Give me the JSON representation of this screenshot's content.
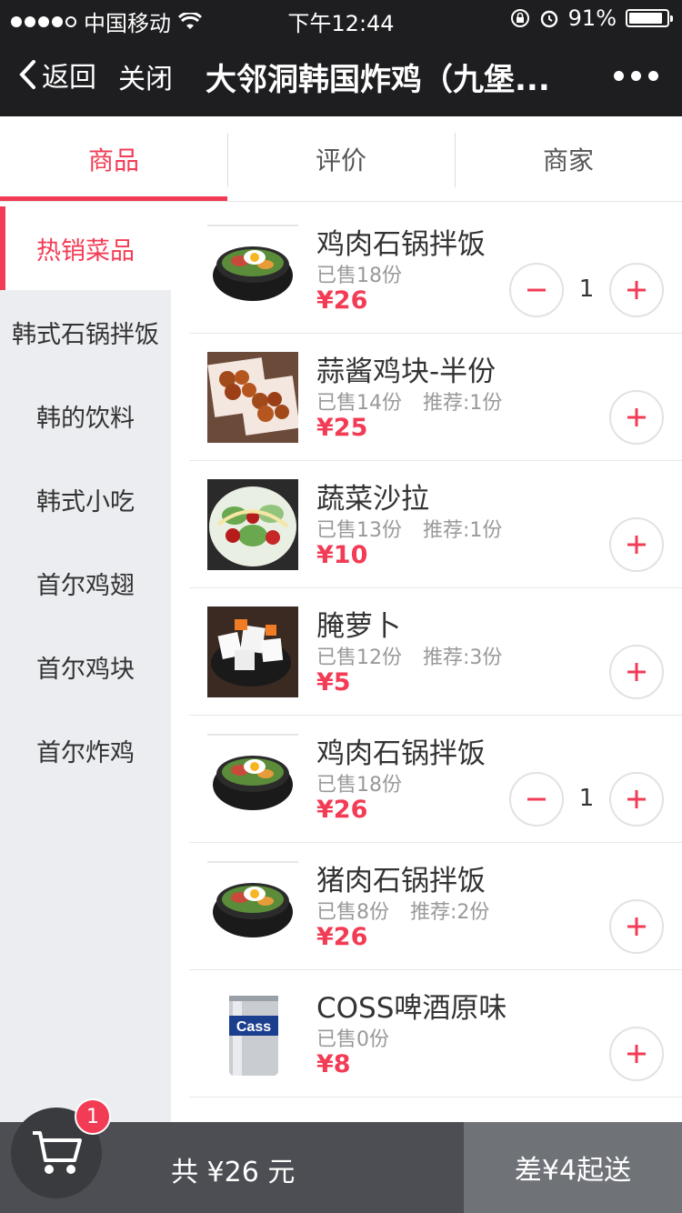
{
  "status_bar": {
    "carrier": "中国移动",
    "time": "下午12:44",
    "battery": "91%",
    "battery_level": 0.91
  },
  "nav": {
    "back_label": "返回",
    "close_label": "关闭",
    "title": "大邻洞韩国炸鸡（九堡..."
  },
  "tabs": [
    {
      "label": "商品"
    },
    {
      "label": "评价"
    },
    {
      "label": "商家"
    }
  ],
  "sidebar": {
    "items": [
      {
        "label": "热销菜品"
      },
      {
        "label": "韩式石锅拌饭"
      },
      {
        "label": "韩的饮料"
      },
      {
        "label": "韩式小吃"
      },
      {
        "label": "首尔鸡翅"
      },
      {
        "label": "首尔鸡块"
      },
      {
        "label": "首尔炸鸡"
      }
    ]
  },
  "products": [
    {
      "name": "鸡肉石锅拌饭",
      "sales": "已售18份",
      "recommend": "",
      "price": "¥26",
      "qty": "1",
      "image": "bibimbap-image"
    },
    {
      "name": "蒜酱鸡块-半份",
      "sales": "已售14份",
      "recommend": "推荐:1份",
      "price": "¥25",
      "qty": "",
      "image": "fried-chicken-image"
    },
    {
      "name": "蔬菜沙拉",
      "sales": "已售13份",
      "recommend": "推荐:1份",
      "price": "¥10",
      "qty": "",
      "image": "salad-image"
    },
    {
      "name": "腌萝卜",
      "sales": "已售12份",
      "recommend": "推荐:3份",
      "price": "¥5",
      "qty": "",
      "image": "pickled-radish-image"
    },
    {
      "name": "鸡肉石锅拌饭",
      "sales": "已售18份",
      "recommend": "",
      "price": "¥26",
      "qty": "1",
      "image": "bibimbap-image"
    },
    {
      "name": "猪肉石锅拌饭",
      "sales": "已售8份",
      "recommend": "推荐:2份",
      "price": "¥26",
      "qty": "",
      "image": "bibimbap-image"
    },
    {
      "name": "COSS啤酒原味",
      "sales": "已售0份",
      "recommend": "",
      "price": "¥8",
      "qty": "",
      "image": "beer-can-image"
    }
  ],
  "cart": {
    "badge": "1",
    "total_label": "共 ¥26 元",
    "checkout_label": "差¥4起送"
  },
  "colors": {
    "accent": "#f23c55",
    "nav_bg": "#1e1e20",
    "sidebar_bg": "#ecedf0",
    "bottom_bg": "#4c4e53"
  }
}
